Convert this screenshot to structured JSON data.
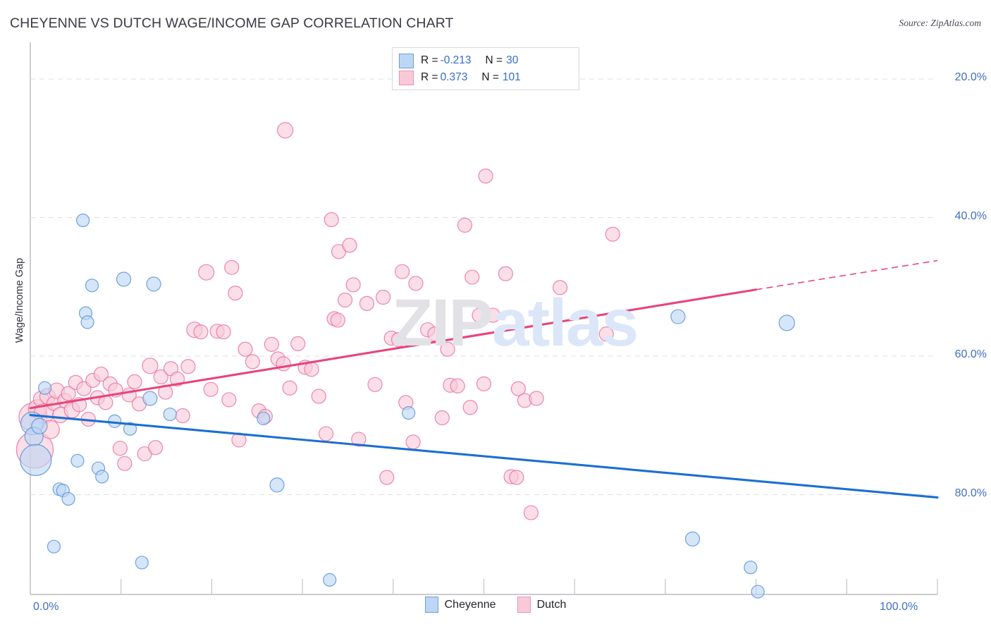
{
  "header": {
    "title": "CHEYENNE VS DUTCH WAGE/INCOME GAP CORRELATION CHART",
    "source": "Source: ZipAtlas.com"
  },
  "watermark": {
    "part1": "ZIP",
    "part2": "atlas"
  },
  "legend_box": {
    "rows": [
      {
        "series": "Cheyenne",
        "r_label": "R =",
        "r_value": "-0.213",
        "n_label": "N =",
        "n_value": "30",
        "color": "#bcd7f5"
      },
      {
        "series": "Dutch",
        "r_label": "R =",
        "r_value": "0.373",
        "n_label": "N =",
        "n_value": "101",
        "color": "#f9c9d8"
      }
    ]
  },
  "bottom_legend": [
    {
      "label": "Cheyenne",
      "color": "#bcd7f5"
    },
    {
      "label": "Dutch",
      "color": "#f9c9d8"
    }
  ],
  "axes": {
    "y_title": "Wage/Income Gap",
    "y_ticks": [
      "80.0%",
      "60.0%",
      "40.0%",
      "20.0%"
    ],
    "x_ticks_visible": [
      "0.0%",
      "100.0%"
    ]
  },
  "chart_data": {
    "type": "scatter",
    "title": "CHEYENNE VS DUTCH WAGE/INCOME GAP CORRELATION CHART",
    "xlabel": "",
    "ylabel": "Wage/Income Gap",
    "xlim": [
      0,
      100
    ],
    "ylim": [
      5.6,
      85.3
    ],
    "x_tick_values": [
      0,
      10,
      20,
      30,
      40,
      50,
      60,
      70,
      80,
      90,
      100
    ],
    "y_tick_values": [
      20,
      40,
      60,
      80
    ],
    "grid": "horizontal-dashed",
    "legend_position": "bottom-center",
    "series": [
      {
        "name": "Cheyenne",
        "color": "#bcd7f5",
        "border": "#5b92d6",
        "R": -0.213,
        "N": 30,
        "trendline": {
          "x0": 0,
          "y0": 31.5,
          "x1": 100,
          "y1": 19.6,
          "style": "solid",
          "color": "#1c6fd0"
        },
        "points": [
          {
            "x": 0.2,
            "y": 30.3,
            "r": 16
          },
          {
            "x": 0.4,
            "y": 28.4,
            "r": 13
          },
          {
            "x": 0.6,
            "y": 25.0,
            "r": 22
          },
          {
            "x": 1.0,
            "y": 29.9,
            "r": 11
          },
          {
            "x": 1.6,
            "y": 35.4,
            "r": 9
          },
          {
            "x": 2.6,
            "y": 12.5,
            "r": 9
          },
          {
            "x": 3.2,
            "y": 20.8,
            "r": 9
          },
          {
            "x": 3.6,
            "y": 20.6,
            "r": 9
          },
          {
            "x": 4.2,
            "y": 19.4,
            "r": 9
          },
          {
            "x": 5.2,
            "y": 24.9,
            "r": 9
          },
          {
            "x": 5.8,
            "y": 59.6,
            "r": 9
          },
          {
            "x": 6.1,
            "y": 46.2,
            "r": 9
          },
          {
            "x": 6.3,
            "y": 44.9,
            "r": 9
          },
          {
            "x": 6.8,
            "y": 50.2,
            "r": 9
          },
          {
            "x": 7.5,
            "y": 23.8,
            "r": 9
          },
          {
            "x": 7.9,
            "y": 22.6,
            "r": 9
          },
          {
            "x": 9.3,
            "y": 30.6,
            "r": 9
          },
          {
            "x": 10.3,
            "y": 51.1,
            "r": 10
          },
          {
            "x": 11.0,
            "y": 29.5,
            "r": 9
          },
          {
            "x": 12.3,
            "y": 10.2,
            "r": 9
          },
          {
            "x": 13.2,
            "y": 33.9,
            "r": 10
          },
          {
            "x": 13.6,
            "y": 50.4,
            "r": 10
          },
          {
            "x": 15.4,
            "y": 31.6,
            "r": 9
          },
          {
            "x": 25.7,
            "y": 31.0,
            "r": 9
          },
          {
            "x": 27.2,
            "y": 21.4,
            "r": 10
          },
          {
            "x": 33.0,
            "y": 7.7,
            "r": 9
          },
          {
            "x": 41.7,
            "y": 31.8,
            "r": 9
          },
          {
            "x": 71.4,
            "y": 45.7,
            "r": 10
          },
          {
            "x": 73.0,
            "y": 13.6,
            "r": 10
          },
          {
            "x": 83.4,
            "y": 44.8,
            "r": 11
          },
          {
            "x": 80.2,
            "y": 6.0,
            "r": 9
          },
          {
            "x": 79.4,
            "y": 9.5,
            "r": 9
          }
        ]
      },
      {
        "name": "Dutch",
        "color": "#f9c9d8",
        "border": "#e8739d",
        "R": 0.373,
        "N": 101,
        "trendline": {
          "x0": 0,
          "y0": 32.5,
          "x1": 80,
          "y1": 49.6,
          "x_dash_end": 100,
          "y_dash_end": 53.8,
          "style": "solid-then-dashed",
          "color": "#e8447c"
        },
        "points": [
          {
            "x": 0.3,
            "y": 31.2,
            "r": 20
          },
          {
            "x": 0.5,
            "y": 26.5,
            "r": 26
          },
          {
            "x": 0.8,
            "y": 32.4,
            "r": 13
          },
          {
            "x": 1.2,
            "y": 33.8,
            "r": 11
          },
          {
            "x": 1.5,
            "y": 31.7,
            "r": 14
          },
          {
            "x": 1.9,
            "y": 34.2,
            "r": 11
          },
          {
            "x": 2.2,
            "y": 29.4,
            "r": 13
          },
          {
            "x": 2.6,
            "y": 33.2,
            "r": 10
          },
          {
            "x": 2.9,
            "y": 35.0,
            "r": 11
          },
          {
            "x": 3.3,
            "y": 31.5,
            "r": 11
          },
          {
            "x": 3.8,
            "y": 33.6,
            "r": 10
          },
          {
            "x": 4.2,
            "y": 34.6,
            "r": 10
          },
          {
            "x": 4.6,
            "y": 32.2,
            "r": 11
          },
          {
            "x": 5.0,
            "y": 36.2,
            "r": 10
          },
          {
            "x": 5.4,
            "y": 33.0,
            "r": 10
          },
          {
            "x": 5.9,
            "y": 35.3,
            "r": 10
          },
          {
            "x": 6.4,
            "y": 30.9,
            "r": 10
          },
          {
            "x": 6.9,
            "y": 36.5,
            "r": 10
          },
          {
            "x": 7.4,
            "y": 34.0,
            "r": 10
          },
          {
            "x": 7.8,
            "y": 37.4,
            "r": 10
          },
          {
            "x": 8.3,
            "y": 33.3,
            "r": 10
          },
          {
            "x": 8.8,
            "y": 36.0,
            "r": 10
          },
          {
            "x": 9.4,
            "y": 35.1,
            "r": 10
          },
          {
            "x": 9.9,
            "y": 26.7,
            "r": 10
          },
          {
            "x": 10.4,
            "y": 24.5,
            "r": 10
          },
          {
            "x": 10.9,
            "y": 34.4,
            "r": 10
          },
          {
            "x": 11.5,
            "y": 36.3,
            "r": 10
          },
          {
            "x": 12.0,
            "y": 33.1,
            "r": 10
          },
          {
            "x": 12.6,
            "y": 25.9,
            "r": 10
          },
          {
            "x": 13.2,
            "y": 38.6,
            "r": 11
          },
          {
            "x": 13.8,
            "y": 26.8,
            "r": 10
          },
          {
            "x": 14.4,
            "y": 37.0,
            "r": 10
          },
          {
            "x": 14.9,
            "y": 34.8,
            "r": 10
          },
          {
            "x": 15.5,
            "y": 38.2,
            "r": 10
          },
          {
            "x": 16.2,
            "y": 36.7,
            "r": 10
          },
          {
            "x": 16.8,
            "y": 31.4,
            "r": 10
          },
          {
            "x": 17.4,
            "y": 38.5,
            "r": 10
          },
          {
            "x": 18.1,
            "y": 43.8,
            "r": 11
          },
          {
            "x": 18.8,
            "y": 43.5,
            "r": 10
          },
          {
            "x": 19.4,
            "y": 52.1,
            "r": 11
          },
          {
            "x": 19.9,
            "y": 35.2,
            "r": 10
          },
          {
            "x": 20.6,
            "y": 43.6,
            "r": 10
          },
          {
            "x": 21.3,
            "y": 43.5,
            "r": 10
          },
          {
            "x": 21.9,
            "y": 33.7,
            "r": 10
          },
          {
            "x": 22.6,
            "y": 49.1,
            "r": 10
          },
          {
            "x": 22.2,
            "y": 52.8,
            "r": 10
          },
          {
            "x": 23.0,
            "y": 27.9,
            "r": 10
          },
          {
            "x": 23.7,
            "y": 41.0,
            "r": 10
          },
          {
            "x": 24.5,
            "y": 39.2,
            "r": 10
          },
          {
            "x": 25.2,
            "y": 32.1,
            "r": 10
          },
          {
            "x": 25.9,
            "y": 31.3,
            "r": 10
          },
          {
            "x": 26.6,
            "y": 41.7,
            "r": 10
          },
          {
            "x": 27.3,
            "y": 39.6,
            "r": 10
          },
          {
            "x": 27.9,
            "y": 38.9,
            "r": 10
          },
          {
            "x": 28.6,
            "y": 35.4,
            "r": 10
          },
          {
            "x": 29.5,
            "y": 41.8,
            "r": 10
          },
          {
            "x": 30.3,
            "y": 38.4,
            "r": 10
          },
          {
            "x": 31.0,
            "y": 38.1,
            "r": 10
          },
          {
            "x": 31.8,
            "y": 34.2,
            "r": 10
          },
          {
            "x": 32.6,
            "y": 28.8,
            "r": 10
          },
          {
            "x": 28.1,
            "y": 72.6,
            "r": 11
          },
          {
            "x": 33.5,
            "y": 45.4,
            "r": 10
          },
          {
            "x": 33.9,
            "y": 45.2,
            "r": 10
          },
          {
            "x": 34.7,
            "y": 48.1,
            "r": 10
          },
          {
            "x": 35.6,
            "y": 50.3,
            "r": 10
          },
          {
            "x": 33.2,
            "y": 59.7,
            "r": 10
          },
          {
            "x": 34.0,
            "y": 55.1,
            "r": 10
          },
          {
            "x": 35.2,
            "y": 56.0,
            "r": 10
          },
          {
            "x": 36.2,
            "y": 28.0,
            "r": 10
          },
          {
            "x": 37.1,
            "y": 47.6,
            "r": 10
          },
          {
            "x": 38.0,
            "y": 35.9,
            "r": 10
          },
          {
            "x": 38.9,
            "y": 48.5,
            "r": 10
          },
          {
            "x": 39.8,
            "y": 42.6,
            "r": 10
          },
          {
            "x": 40.6,
            "y": 42.4,
            "r": 10
          },
          {
            "x": 39.3,
            "y": 22.5,
            "r": 10
          },
          {
            "x": 41.4,
            "y": 33.3,
            "r": 10
          },
          {
            "x": 42.2,
            "y": 27.6,
            "r": 10
          },
          {
            "x": 41.0,
            "y": 52.2,
            "r": 10
          },
          {
            "x": 42.5,
            "y": 50.5,
            "r": 10
          },
          {
            "x": 43.8,
            "y": 43.8,
            "r": 10
          },
          {
            "x": 44.6,
            "y": 43.2,
            "r": 10
          },
          {
            "x": 45.4,
            "y": 31.1,
            "r": 10
          },
          {
            "x": 46.3,
            "y": 35.8,
            "r": 10
          },
          {
            "x": 47.1,
            "y": 35.7,
            "r": 10
          },
          {
            "x": 48.7,
            "y": 51.4,
            "r": 10
          },
          {
            "x": 47.9,
            "y": 58.9,
            "r": 10
          },
          {
            "x": 50.2,
            "y": 66.0,
            "r": 10
          },
          {
            "x": 49.5,
            "y": 45.9,
            "r": 10
          },
          {
            "x": 51.0,
            "y": 45.9,
            "r": 10
          },
          {
            "x": 50.0,
            "y": 36.0,
            "r": 10
          },
          {
            "x": 48.5,
            "y": 32.6,
            "r": 10
          },
          {
            "x": 52.4,
            "y": 51.9,
            "r": 10
          },
          {
            "x": 53.8,
            "y": 35.3,
            "r": 10
          },
          {
            "x": 54.5,
            "y": 33.6,
            "r": 10
          },
          {
            "x": 55.8,
            "y": 33.9,
            "r": 10
          },
          {
            "x": 53.0,
            "y": 22.6,
            "r": 10
          },
          {
            "x": 53.6,
            "y": 22.5,
            "r": 10
          },
          {
            "x": 55.2,
            "y": 17.4,
            "r": 10
          },
          {
            "x": 58.4,
            "y": 49.9,
            "r": 10
          },
          {
            "x": 64.2,
            "y": 57.6,
            "r": 10
          },
          {
            "x": 63.5,
            "y": 43.2,
            "r": 10
          },
          {
            "x": 46.0,
            "y": 41.0,
            "r": 10
          }
        ]
      }
    ]
  }
}
